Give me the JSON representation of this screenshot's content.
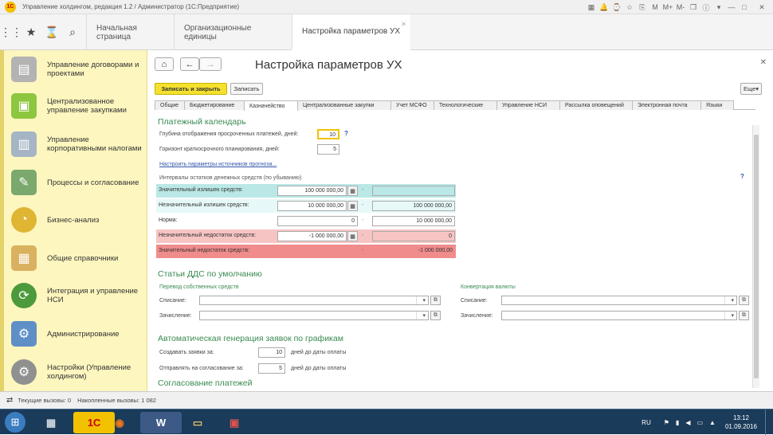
{
  "window": {
    "title": "Управление холдингом, редакция 1.2 / Администратор  (1С:Предприятие)"
  },
  "topbar": {
    "tabs": [
      {
        "label": "Начальная страница"
      },
      {
        "label": "Организационные единицы"
      },
      {
        "label": "Настройка параметров УХ"
      }
    ]
  },
  "sidebar": {
    "items": [
      {
        "label": "Управление договорами и проектами",
        "icon": "document-icon",
        "color": "#b3b3b3"
      },
      {
        "label": "Централизованное управление закупками",
        "icon": "gift-icon",
        "color": "#8dc63f"
      },
      {
        "label": "Управление корпоративными налогами",
        "icon": "tax-icon",
        "color": "#a5b5c5"
      },
      {
        "label": "Процессы и согласование",
        "icon": "process-icon",
        "color": "#7aa86d"
      },
      {
        "label": "Бизнес-анализ",
        "icon": "chart-icon",
        "color": "#e0b533"
      },
      {
        "label": "Общие справочники",
        "icon": "book-icon",
        "color": "#d9b15f"
      },
      {
        "label": "Интеграция и управление НСИ",
        "icon": "integration-icon",
        "color": "#4c9a3c"
      },
      {
        "label": "Администрирование",
        "icon": "admin-icon",
        "color": "#5f8fc6"
      },
      {
        "label": "Настройки (Управление холдингом)",
        "icon": "gears-icon",
        "color": "#909090"
      }
    ]
  },
  "form": {
    "title": "Настройка параметров УХ",
    "save_close_label": "Записать и закрыть",
    "save_label": "Записать",
    "more_label": "Еще",
    "tabs": [
      {
        "label": "Общие"
      },
      {
        "label": "Бюджетирование"
      },
      {
        "label": "Казначейство"
      },
      {
        "label": "Централизованные закупки"
      },
      {
        "label": "Учет МСФО"
      },
      {
        "label": "Технологические"
      },
      {
        "label": "Управление НСИ"
      },
      {
        "label": "Рассылка оповещений"
      },
      {
        "label": "Электронная почта"
      },
      {
        "label": "Языки"
      }
    ],
    "payment_calendar": {
      "title": "Платежный календарь",
      "depth_label": "Глубина отображения просроченных платежей, дней:",
      "depth_value": "10",
      "horizon_label": "Горизонт краткосрочного планирования, дней:",
      "horizon_value": "5",
      "forecast_link": "Настроить параметры источников прогноза...",
      "intervals_label": "Интервалы остатков денежных средств (по убыванию)",
      "help": "?",
      "intervals": [
        {
          "label": "Значительный излишек средств:",
          "from": "100 000 000,00",
          "to": "",
          "color": "#b9e8e6"
        },
        {
          "label": "Незначительный излишек средств:",
          "from": "10 000 000,00",
          "to": "100 000 000,00",
          "color": "#e7f8f8"
        },
        {
          "label": "Норма:",
          "from": "0",
          "to": "10 000 000,00",
          "color": "#ffffff"
        },
        {
          "label": "Незначительный недостаток средств:",
          "from": "-1 000 000,00",
          "to": "0",
          "color": "#f7c4c4"
        },
        {
          "label": "Значительный недостаток средств:",
          "from": "",
          "to": "-1 000 000,00",
          "color": "#f08c8c"
        }
      ]
    },
    "cash_flow_items": {
      "title": "Статьи ДДС по умолчанию",
      "own_transfer": {
        "label": "Перевод собственных средств",
        "debit_label": "Списание:",
        "credit_label": "Зачисление:"
      },
      "fx_conversion": {
        "label": "Конвертация валюты",
        "debit_label": "Списание:",
        "credit_label": "Зачисление:"
      }
    },
    "auto_requests": {
      "title": "Автоматическая генерация заявок по графикам",
      "create_label": "Создавать заявки за:",
      "create_value": "10",
      "create_suffix": "дней до даты оплаты",
      "approve_label": "Отправлять на согласование за:",
      "approve_value": "5",
      "approve_suffix": "дней до даты оплаты",
      "next_section": "Согласование платежей"
    }
  },
  "statusbar": {
    "current_calls": "Текущие вызовы:  0",
    "accumulated_calls": "Накопленные вызовы:  1 082"
  },
  "taskbar": {
    "apps": [
      {
        "label": "1С",
        "icon": "1c-icon"
      },
      {
        "label": "W",
        "icon": "word-icon"
      }
    ],
    "lang": "RU",
    "time": "13:12",
    "date": "01.09.2016"
  }
}
